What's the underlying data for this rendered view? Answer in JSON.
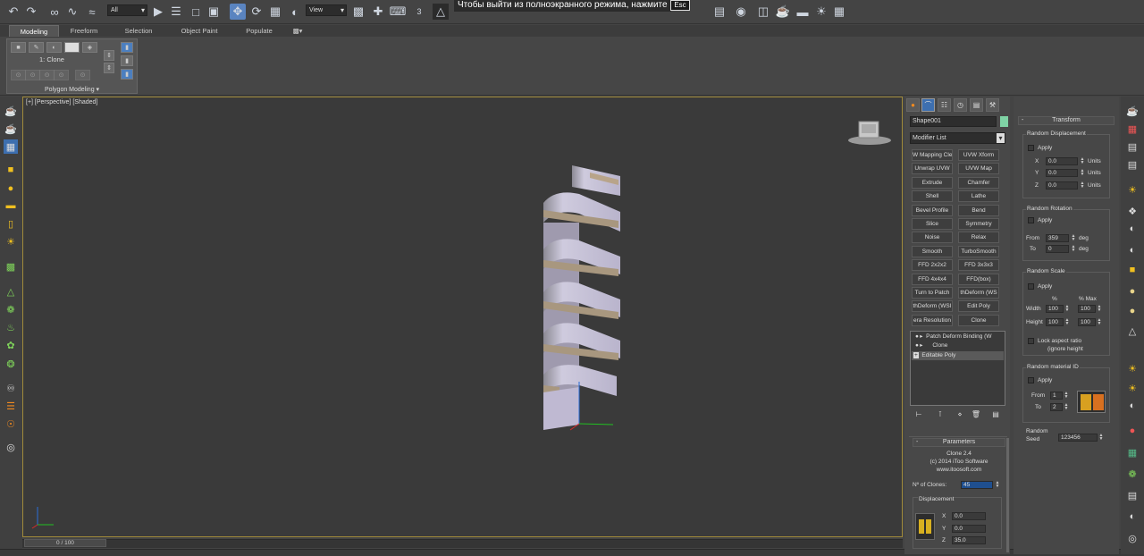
{
  "fullscreen_notice": {
    "message": "Чтобы выйти из полноэкранного режима, нажмите",
    "key": "Esc"
  },
  "toolbar": {
    "selection_filter": "All",
    "reference_coord": "View",
    "snap_label": "3"
  },
  "ribbon": {
    "tabs": [
      "Modeling",
      "Freeform",
      "Selection",
      "Object Paint",
      "Populate"
    ],
    "active_tab": "Modeling",
    "group_title": "1: Clone",
    "panel_label": "Polygon Modeling ▾"
  },
  "viewport": {
    "label": "[+] [Perspective] [Shaded]"
  },
  "timeline": {
    "frame": "0 / 100"
  },
  "command_panel": {
    "tabs": [
      "create",
      "modify",
      "hierarchy",
      "motion",
      "display",
      "utilities"
    ],
    "object_name": "Shape001",
    "object_color": "#7fd3a5",
    "modifier_list": "Modifier List",
    "modifier_buttons": [
      "W Mapping Cle",
      "UVW Xform",
      "Unwrap UVW",
      "UVW Map",
      "Extrude",
      "Chamfer",
      "Shell",
      "Lathe",
      "Bevel Profile",
      "Bend",
      "Slice",
      "Symmetry",
      "Noise",
      "Relax",
      "Smooth",
      "TurboSmooth",
      "FFD 2x2x2",
      "FFD 3x3x3",
      "FFD 4x4x4",
      "FFD(box)",
      "Turn to Patch",
      "thDeform (WS",
      "thDeform (WSI",
      "Edit Poly",
      "era Resolution",
      "Clone"
    ],
    "stack": [
      "Patch Deform Binding (W",
      "Clone",
      "Editable Poly"
    ],
    "params": {
      "title": "Parameters",
      "plugin": "Clone 2.4",
      "copyright": "(c) 2014 iToo Software",
      "site": "www.itoosoft.com",
      "clones_label": "Nº of Clones:",
      "clones_value": "45",
      "displacement_title": "Displacement",
      "x": "0.0",
      "y": "0.0",
      "z": "35.0"
    }
  },
  "transform_panel": {
    "title": "Transform",
    "random_displacement": {
      "title": "Random Displacement",
      "apply": "Apply",
      "x": "0.0",
      "y": "0.0",
      "z": "0.0",
      "units": "Units"
    },
    "random_rotation": {
      "title": "Random Rotation",
      "apply": "Apply",
      "from_label": "From",
      "from": "359",
      "to_label": "To",
      "to": "0",
      "unit": "deg"
    },
    "random_scale": {
      "title": "Random Scale",
      "apply": "Apply",
      "pct": "%",
      "pct_max": "% Max",
      "width_label": "Width",
      "width_min": "100",
      "width_max": "100",
      "height_label": "Height",
      "height_min": "100",
      "height_max": "100",
      "lock_label": "Lock aspect ratio",
      "lock_sub": "(ignore height"
    },
    "random_material": {
      "title": "Random material ID",
      "apply": "Apply",
      "from_label": "From",
      "from": "1",
      "to_label": "To",
      "to": "2"
    },
    "seed_label": "Random\nSeed",
    "seed_label_1": "Random",
    "seed_label_2": "Seed",
    "seed": "123456"
  }
}
